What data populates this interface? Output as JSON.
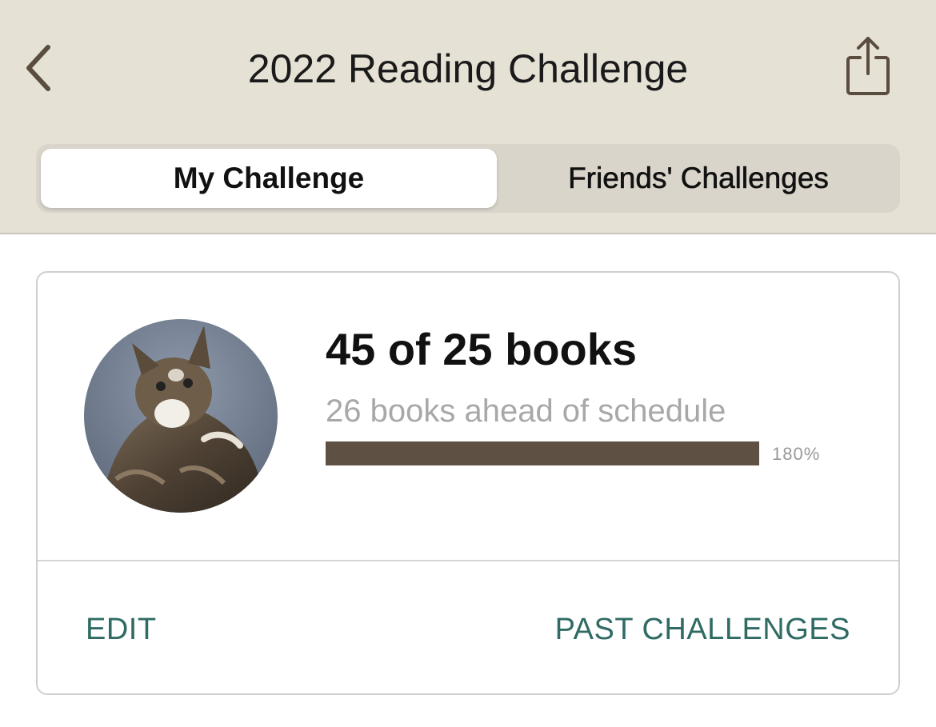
{
  "header": {
    "title": "2022 Reading Challenge",
    "back_icon": "chevron-left-icon",
    "share_icon": "share-icon"
  },
  "tabs": [
    {
      "label": "My Challenge",
      "selected": true
    },
    {
      "label": "Friends' Challenges",
      "selected": false
    }
  ],
  "challenge": {
    "count_text": "45 of 25 books",
    "status_text": "26 books ahead of schedule",
    "progress_percent": 100,
    "progress_label": "180%",
    "avatar": "cat-photo"
  },
  "actions": {
    "edit_label": "EDIT",
    "past_label": "PAST CHALLENGES"
  },
  "colors": {
    "header_bg": "#e6e1d5",
    "accent": "#2f6b63",
    "progress_fill": "#5e5144"
  }
}
